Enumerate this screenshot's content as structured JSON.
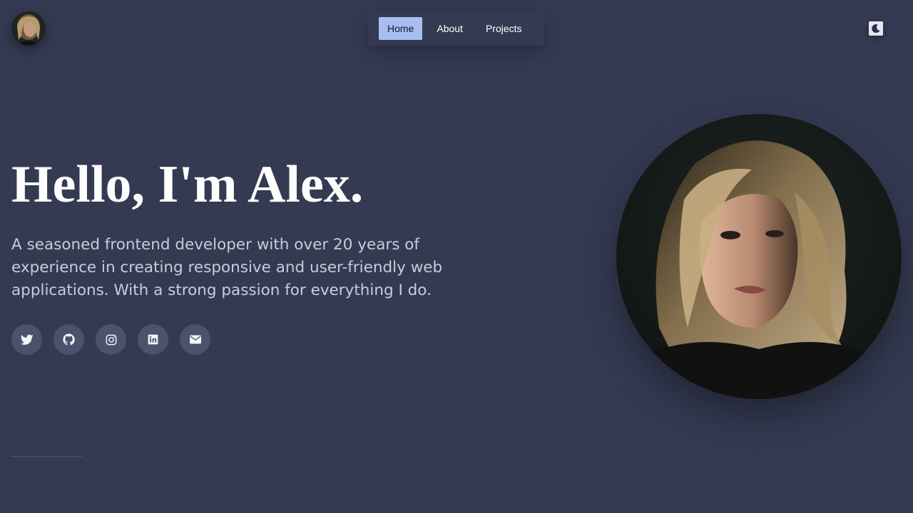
{
  "header": {
    "avatar_alt": "Alex avatar",
    "nav": [
      {
        "label": "Home",
        "active": true
      },
      {
        "label": "About",
        "active": false
      },
      {
        "label": "Projects",
        "active": false
      }
    ],
    "theme_toggle_icon": "moon-icon"
  },
  "hero": {
    "title": "Hello, I'm Alex.",
    "description": "A seasoned frontend developer with over 20 years of experience in creating responsive and user-friendly web applications. With a strong passion for everything I do.",
    "socials": [
      {
        "icon": "twitter-icon"
      },
      {
        "icon": "github-icon"
      },
      {
        "icon": "instagram-icon"
      },
      {
        "icon": "linkedin-icon"
      },
      {
        "icon": "mail-icon"
      }
    ]
  },
  "colors": {
    "background": "#343a52",
    "nav_active_bg": "#a9bdf2",
    "social_bg": "#4b526b",
    "description_text": "#c9cdd8"
  }
}
